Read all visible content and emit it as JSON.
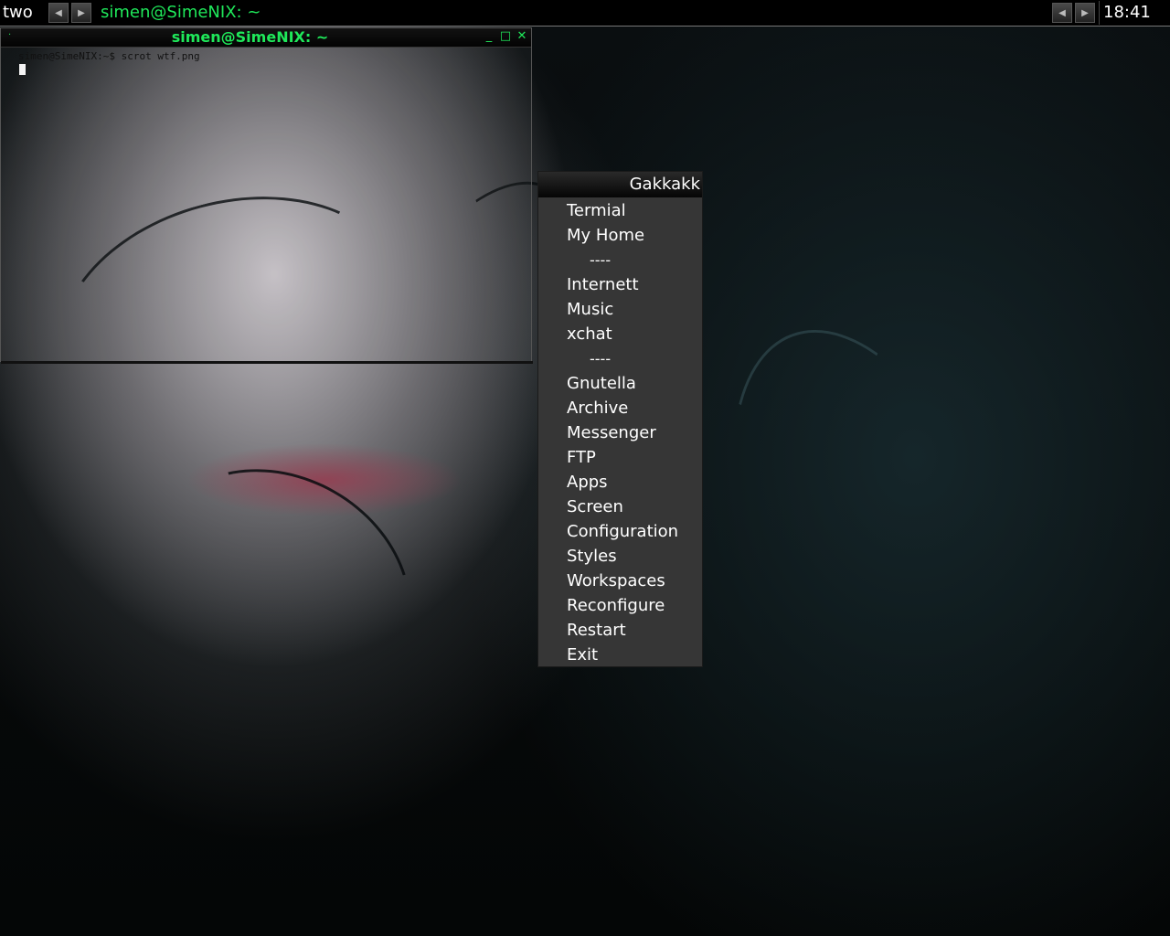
{
  "topbar": {
    "workspace": "two",
    "prev_icon": "left-arrow-icon",
    "next_icon": "right-arrow-icon",
    "window_title": "simen@SimeNIX: ~",
    "clock": "18:41"
  },
  "terminal": {
    "title": "simen@SimeNIX: ~",
    "prompt_line": "simen@SimeNIX:~$ scrot wtf.png",
    "title_color": "#1fe85a"
  },
  "menu": {
    "title": "Gakkakk",
    "items": [
      {
        "label": "Termial"
      },
      {
        "label": "My Home"
      },
      {
        "label": "----",
        "separator": true
      },
      {
        "label": "Internett"
      },
      {
        "label": "Music"
      },
      {
        "label": "xchat"
      },
      {
        "label": "----",
        "separator": true
      },
      {
        "label": "Gnutella"
      },
      {
        "label": "Archive"
      },
      {
        "label": "Messenger"
      },
      {
        "label": "FTP"
      },
      {
        "label": "Apps"
      },
      {
        "label": "Screen"
      },
      {
        "label": "Configuration"
      },
      {
        "label": "Styles"
      },
      {
        "label": "Workspaces"
      },
      {
        "label": "Reconfigure"
      },
      {
        "label": "Restart"
      },
      {
        "label": "Exit"
      }
    ]
  }
}
